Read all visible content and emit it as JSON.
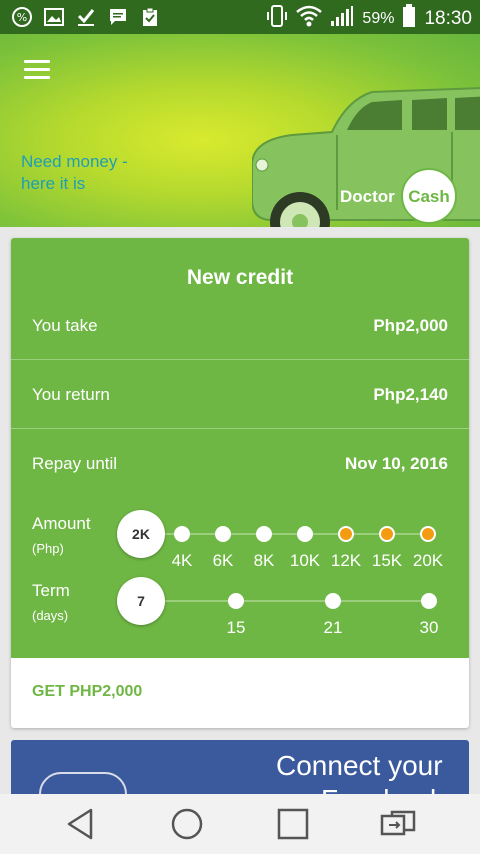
{
  "status_bar": {
    "battery_percent": "59%",
    "time": "18:30"
  },
  "hero": {
    "tagline_line1": "Need money -",
    "tagline_line2": "here it is",
    "logo_text_left": "Doctor",
    "logo_text_right": "Cash"
  },
  "credit_card": {
    "title": "New credit",
    "rows": [
      {
        "label": "You take",
        "value": "Php2,000"
      },
      {
        "label": "You return",
        "value": "Php2,140"
      },
      {
        "label": "Repay until",
        "value": "Nov 10, 2016"
      }
    ],
    "amount": {
      "label": "Amount",
      "unit": "(Php)",
      "selected": "2K",
      "ticks": [
        "4K",
        "6K",
        "8K",
        "10K",
        "12K",
        "15K",
        "20K"
      ],
      "tick_states": [
        "white",
        "white",
        "white",
        "white",
        "orange",
        "orange",
        "orange"
      ]
    },
    "term": {
      "label": "Term",
      "unit": "(days)",
      "selected": "7",
      "ticks": [
        "15",
        "21",
        "30"
      ]
    },
    "cta": "GET PHP2,000"
  },
  "facebook_banner": {
    "line1": "Connect your",
    "line2": "Facebook"
  },
  "colors": {
    "status_bar": "#2f6a1f",
    "green": "#6fb745",
    "accent_orange": "#f39c12",
    "tagline_teal": "#1f9fb3",
    "facebook_blue": "#3b5a9e"
  }
}
